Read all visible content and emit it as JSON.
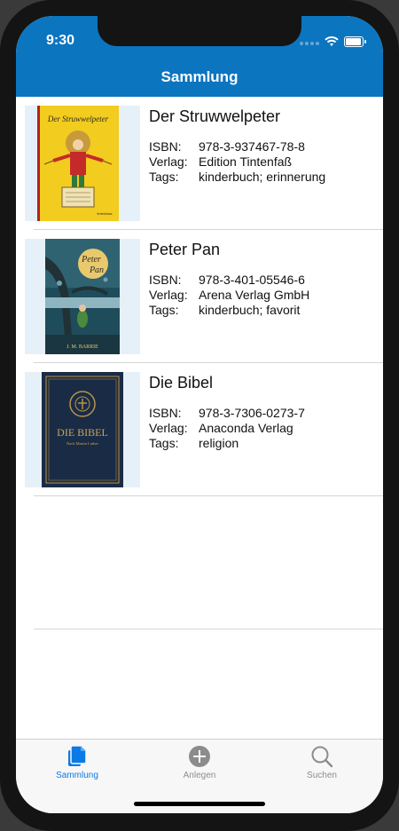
{
  "status_bar": {
    "time": "9:30"
  },
  "navbar": {
    "title": "Sammlung"
  },
  "books": [
    {
      "title": "Der Struwwelpeter",
      "isbn_label": "ISBN:",
      "isbn": "978-3-937467-78-8",
      "publisher_label": "Verlag:",
      "publisher": "Edition Tintenfaß",
      "tags_label": "Tags:",
      "tags": "kinderbuch; erinnerung",
      "cover_title": "Der Struwwelpeter",
      "cover_publisher": "tintenfass"
    },
    {
      "title": "Peter Pan",
      "isbn_label": "ISBN:",
      "isbn": "978-3-401-05546-6",
      "publisher_label": "Verlag:",
      "publisher": "Arena Verlag GmbH",
      "tags_label": "Tags:",
      "tags": "kinderbuch; favorit",
      "cover_title_1": "Peter",
      "cover_title_2": "Pan",
      "cover_author": "J. M. BARRIE"
    },
    {
      "title": "Die Bibel",
      "isbn_label": "ISBN:",
      "isbn": "978-3-7306-0273-7",
      "publisher_label": "Verlag:",
      "publisher": "Anaconda Verlag",
      "tags_label": "Tags:",
      "tags": "religion",
      "cover_title": "DIE BIBEL",
      "cover_subtitle": "Nach Martin Luther"
    }
  ],
  "tabbar": {
    "items": [
      {
        "label": "Sammlung",
        "icon": "documents-icon",
        "active": true
      },
      {
        "label": "Anlegen",
        "icon": "add-circle-icon",
        "active": false
      },
      {
        "label": "Suchen",
        "icon": "magnifier-icon",
        "active": false
      }
    ]
  },
  "colors": {
    "nav_blue": "#0b75c0",
    "tab_active": "#0a7ae6",
    "tab_inactive": "#8c8c8c",
    "cover_background": "#e6f0f8"
  }
}
